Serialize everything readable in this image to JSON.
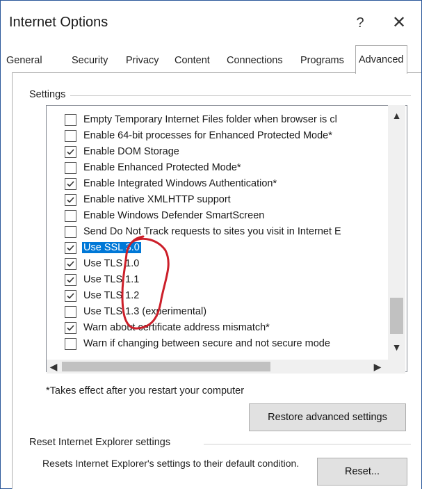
{
  "window": {
    "title": "Internet Options",
    "help_label": "?",
    "close_label": "✕"
  },
  "tabs": [
    {
      "label": "General",
      "active": false
    },
    {
      "label": "Security",
      "active": false
    },
    {
      "label": "Privacy",
      "active": false
    },
    {
      "label": "Content",
      "active": false
    },
    {
      "label": "Connections",
      "active": false
    },
    {
      "label": "Programs",
      "active": false
    },
    {
      "label": "Advanced",
      "active": true
    }
  ],
  "settings": {
    "group_label": "Settings",
    "items": [
      {
        "label": "Empty Temporary Internet Files folder when browser is cl",
        "checked": false,
        "selected": false
      },
      {
        "label": "Enable 64-bit processes for Enhanced Protected Mode*",
        "checked": false,
        "selected": false
      },
      {
        "label": "Enable DOM Storage",
        "checked": true,
        "selected": false
      },
      {
        "label": "Enable Enhanced Protected Mode*",
        "checked": false,
        "selected": false
      },
      {
        "label": "Enable Integrated Windows Authentication*",
        "checked": true,
        "selected": false
      },
      {
        "label": "Enable native XMLHTTP support",
        "checked": true,
        "selected": false
      },
      {
        "label": "Enable Windows Defender SmartScreen",
        "checked": false,
        "selected": false
      },
      {
        "label": "Send Do Not Track requests to sites you visit in Internet E",
        "checked": false,
        "selected": false
      },
      {
        "label": "Use SSL 3.0",
        "checked": true,
        "selected": true
      },
      {
        "label": "Use TLS 1.0",
        "checked": true,
        "selected": false
      },
      {
        "label": "Use TLS 1.1",
        "checked": true,
        "selected": false
      },
      {
        "label": "Use TLS 1.2",
        "checked": true,
        "selected": false
      },
      {
        "label": "Use TLS 1.3 (experimental)",
        "checked": false,
        "selected": false
      },
      {
        "label": "Warn about certificate address mismatch*",
        "checked": true,
        "selected": false
      },
      {
        "label": "Warn if changing between secure and not secure mode",
        "checked": false,
        "selected": false
      }
    ],
    "note": "*Takes effect after you restart your computer",
    "restore_button": "Restore advanced settings"
  },
  "reset_section": {
    "group_label": "Reset Internet Explorer settings",
    "description": "Resets Internet Explorer's settings to their default condition.",
    "reset_button": "Reset..."
  },
  "scrollbar": {
    "up": "▲",
    "down": "▼",
    "left": "◀",
    "right": "▶"
  },
  "colors": {
    "selection": "#0078d7",
    "annotation": "#cc1f2a"
  }
}
